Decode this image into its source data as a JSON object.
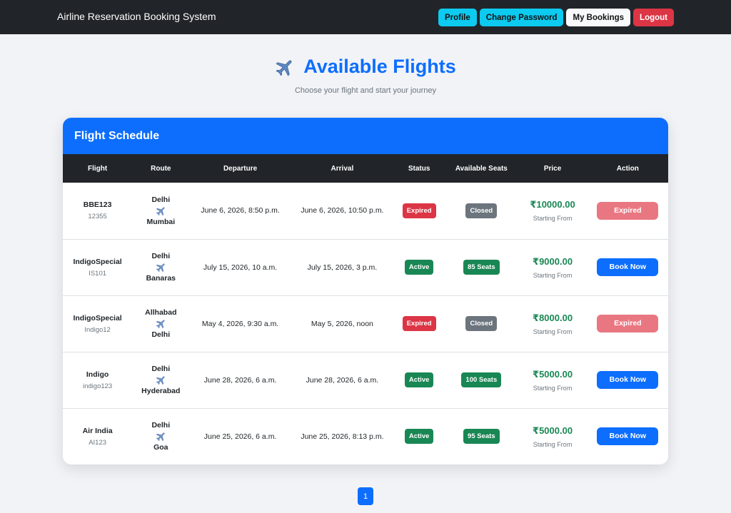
{
  "navbar": {
    "brand": "Airline Reservation Booking System",
    "buttons": [
      "Profile",
      "Change Password",
      "My Bookings",
      "Logout"
    ]
  },
  "hero": {
    "title": "Available Flights",
    "subtitle": "Choose your flight and start your journey"
  },
  "table": {
    "header": "Flight Schedule",
    "columns": [
      "Flight",
      "Route",
      "Departure",
      "Arrival",
      "Status",
      "Available Seats",
      "Price",
      "Action"
    ],
    "rows": [
      {
        "name": "BBE123",
        "code": "12355",
        "from": "Delhi",
        "to": "Mumbai",
        "departure": "June 6, 2026, 8:50 p.m.",
        "arrival": "June 6, 2026, 10:50 p.m.",
        "status": "Expired",
        "seats": "Closed",
        "price": "₹10000.00",
        "price_sub": "Starting From",
        "action": "Expired"
      },
      {
        "name": "IndigoSpecial",
        "code": "IS101",
        "from": "Delhi",
        "to": "Banaras",
        "departure": "July 15, 2026, 10 a.m.",
        "arrival": "July 15, 2026, 3 p.m.",
        "status": "Active",
        "seats": "85 Seats",
        "price": "₹9000.00",
        "price_sub": "Starting From",
        "action": "Book Now"
      },
      {
        "name": "IndigoSpecial",
        "code": "Indigo12",
        "from": "Allhabad",
        "to": "Delhi",
        "departure": "May 4, 2026, 9:30 a.m.",
        "arrival": "May 5, 2026, noon",
        "status": "Expired",
        "seats": "Closed",
        "price": "₹8000.00",
        "price_sub": "Starting From",
        "action": "Expired"
      },
      {
        "name": "Indigo",
        "code": "indigo123",
        "from": "Delhi",
        "to": "Hyderabad",
        "departure": "June 28, 2026, 6 a.m.",
        "arrival": "June 28, 2026, 6 a.m.",
        "status": "Active",
        "seats": "100 Seats",
        "price": "₹5000.00",
        "price_sub": "Starting From",
        "action": "Book Now"
      },
      {
        "name": "Air India",
        "code": "AI123",
        "from": "Delhi",
        "to": "Goa",
        "departure": "June 25, 2026, 6 a.m.",
        "arrival": "June 25, 2026, 8:13 p.m.",
        "status": "Active",
        "seats": "95 Seats",
        "price": "₹5000.00",
        "price_sub": "Starting From",
        "action": "Book Now"
      }
    ]
  },
  "pagination": {
    "current": "1"
  },
  "colors": {
    "primary": "#0d6efd",
    "dark": "#212529",
    "success": "#198754",
    "danger": "#dc3545",
    "info": "#0dcaf0",
    "secondary": "#6c757d"
  }
}
